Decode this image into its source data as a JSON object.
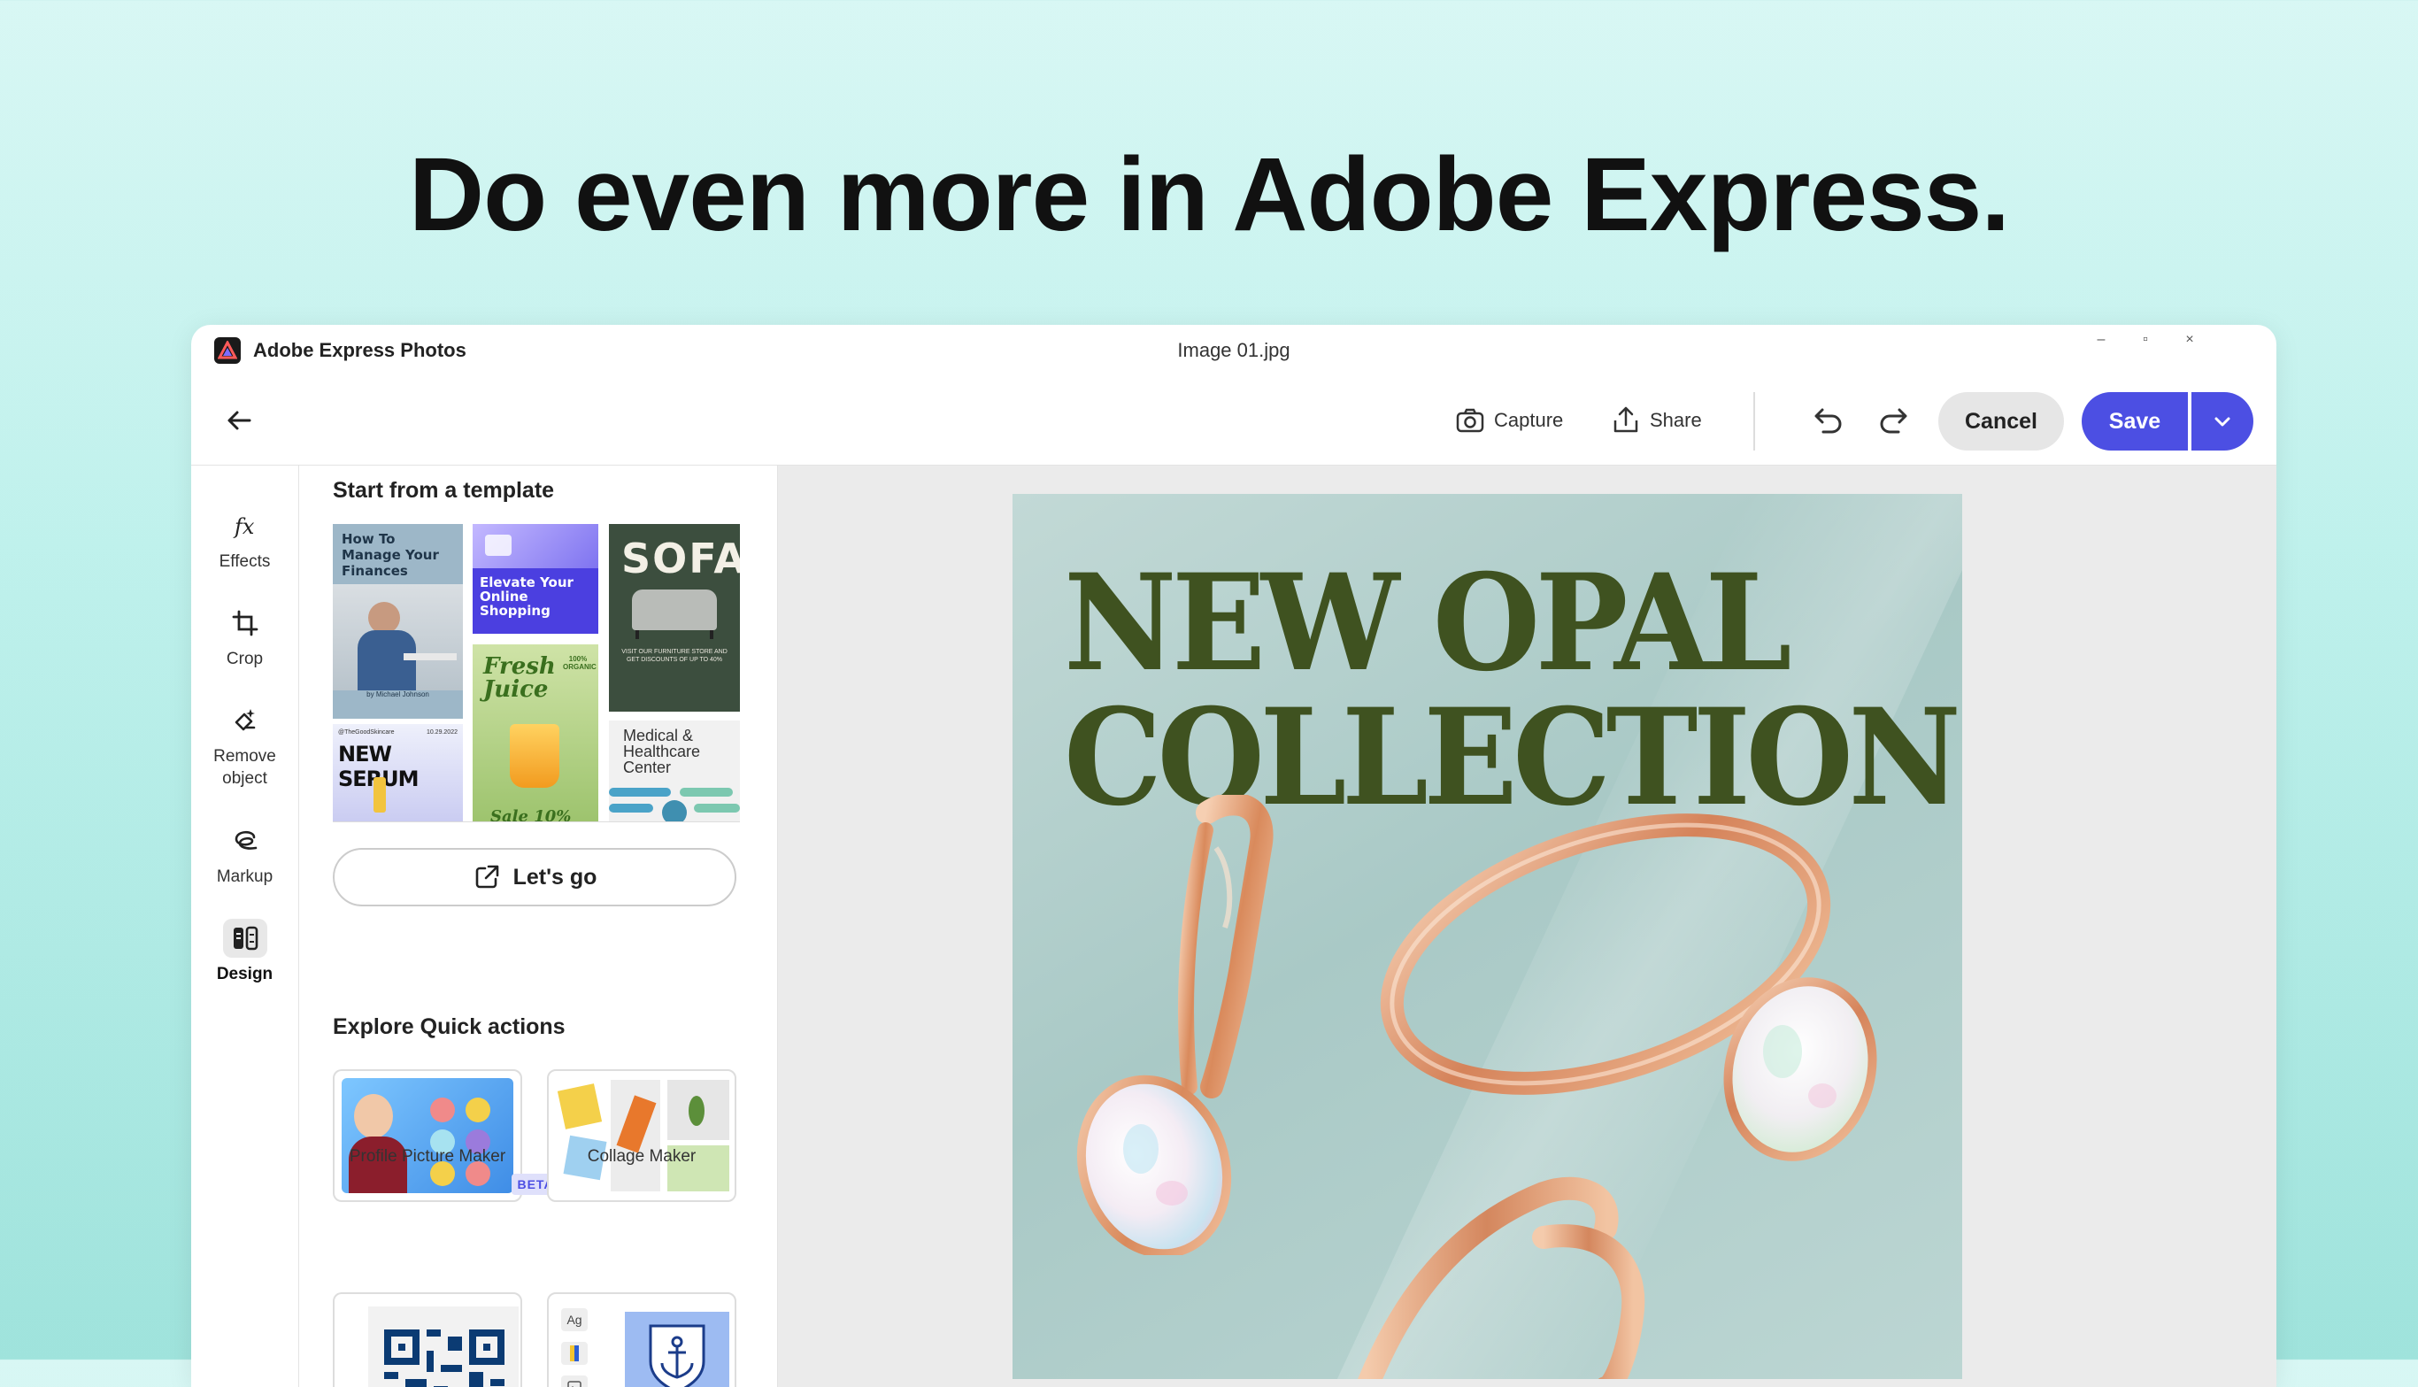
{
  "headline": "Do even more in Adobe Express.",
  "window": {
    "app_title": "Adobe Express Photos",
    "doc_title": "Image 01.jpg",
    "controls": [
      "–",
      "▫",
      "×"
    ]
  },
  "toolbar": {
    "capture_label": "Capture",
    "share_label": "Share",
    "cancel_label": "Cancel",
    "save_label": "Save"
  },
  "rail": {
    "items": [
      {
        "label": "Effects",
        "icon": "fx-icon"
      },
      {
        "label": "Crop",
        "icon": "crop-icon"
      },
      {
        "label": "Remove object",
        "icon": "eraser-icon"
      },
      {
        "label": "Markup",
        "icon": "markup-icon"
      },
      {
        "label": "Design",
        "icon": "design-icon",
        "active": true
      }
    ]
  },
  "panel": {
    "templates_heading": "Start from a template",
    "templates": [
      {
        "text": "How To Manage Your Finances",
        "byline": "by Michael Johnson"
      },
      {
        "text": "Elevate Your Online Shopping"
      },
      {
        "text": "SOFA",
        "fine": "VISIT OUR FURNITURE STORE AND GET DISCOUNTS OF UP TO 40%"
      },
      {
        "text": "NEW SERUM",
        "handle": "@TheGoodSkincare",
        "date": "10.29.2022"
      },
      {
        "text": "Fresh Juice",
        "badge": "100% ORGANIC",
        "sub": "Sale 10%"
      },
      {
        "text": "Medical & Healthcare Center"
      }
    ],
    "lets_go_label": "Let's go",
    "quick_actions_heading": "Explore Quick actions",
    "quick_actions": [
      {
        "label": "Profile Picture Maker",
        "badge": "BETA"
      },
      {
        "label": "Collage Maker"
      },
      {
        "label": ""
      },
      {
        "label": "",
        "glyph": "Ag"
      }
    ]
  },
  "artboard": {
    "title_line1": "NEW OPAL",
    "title_line2": "COLLECTION"
  },
  "colors": {
    "accent": "#4c4fe3",
    "title_green": "#3f5220",
    "rose_gold": "#e0a27d"
  }
}
